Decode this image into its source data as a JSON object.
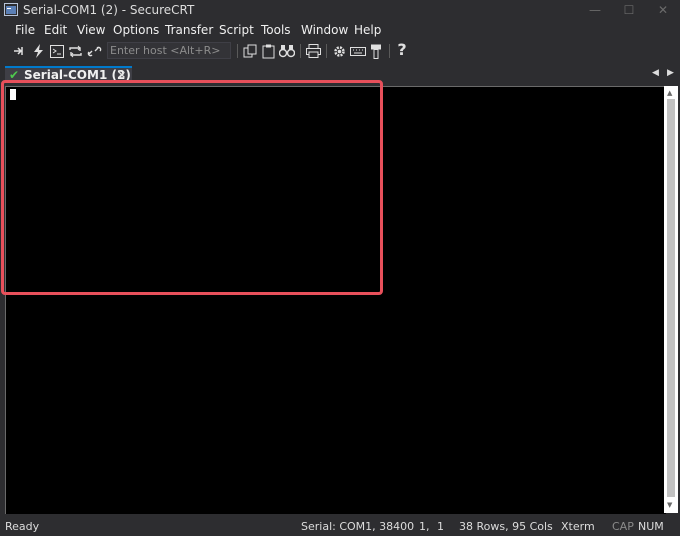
{
  "window": {
    "title": "Serial-COM1 (2) - SecureCRT"
  },
  "menu": {
    "items": [
      "File",
      "Edit",
      "View",
      "Options",
      "Transfer",
      "Script",
      "Tools",
      "Window",
      "Help"
    ]
  },
  "toolbar": {
    "host_placeholder": "Enter host <Alt+R>",
    "icons": [
      "connect-icon",
      "quick-connect-icon",
      "connect-in-tab-icon",
      "reconnect-icon",
      "disconnect-icon",
      "copy-icon",
      "paste-icon",
      "copy-paste-icon",
      "find-icon",
      "print-icon",
      "settings-icon",
      "keymap-icon",
      "sftp-icon",
      "help-icon"
    ]
  },
  "tab": {
    "label": "Serial-COM1 (2)",
    "close": "×"
  },
  "tab_nav": {
    "prev": "◀",
    "next": "▶"
  },
  "status": {
    "ready": "Ready",
    "connection": "Serial: COM1, 38400",
    "row": "1,",
    "col": "1",
    "size": "38 Rows, 95 Cols",
    "terminal": "Xterm",
    "cap": "CAP",
    "num": "NUM"
  },
  "colors": {
    "accent": "#007acc",
    "highlight": "#e8505b",
    "check": "#4ec94e",
    "terminal_bg": "#000000"
  }
}
